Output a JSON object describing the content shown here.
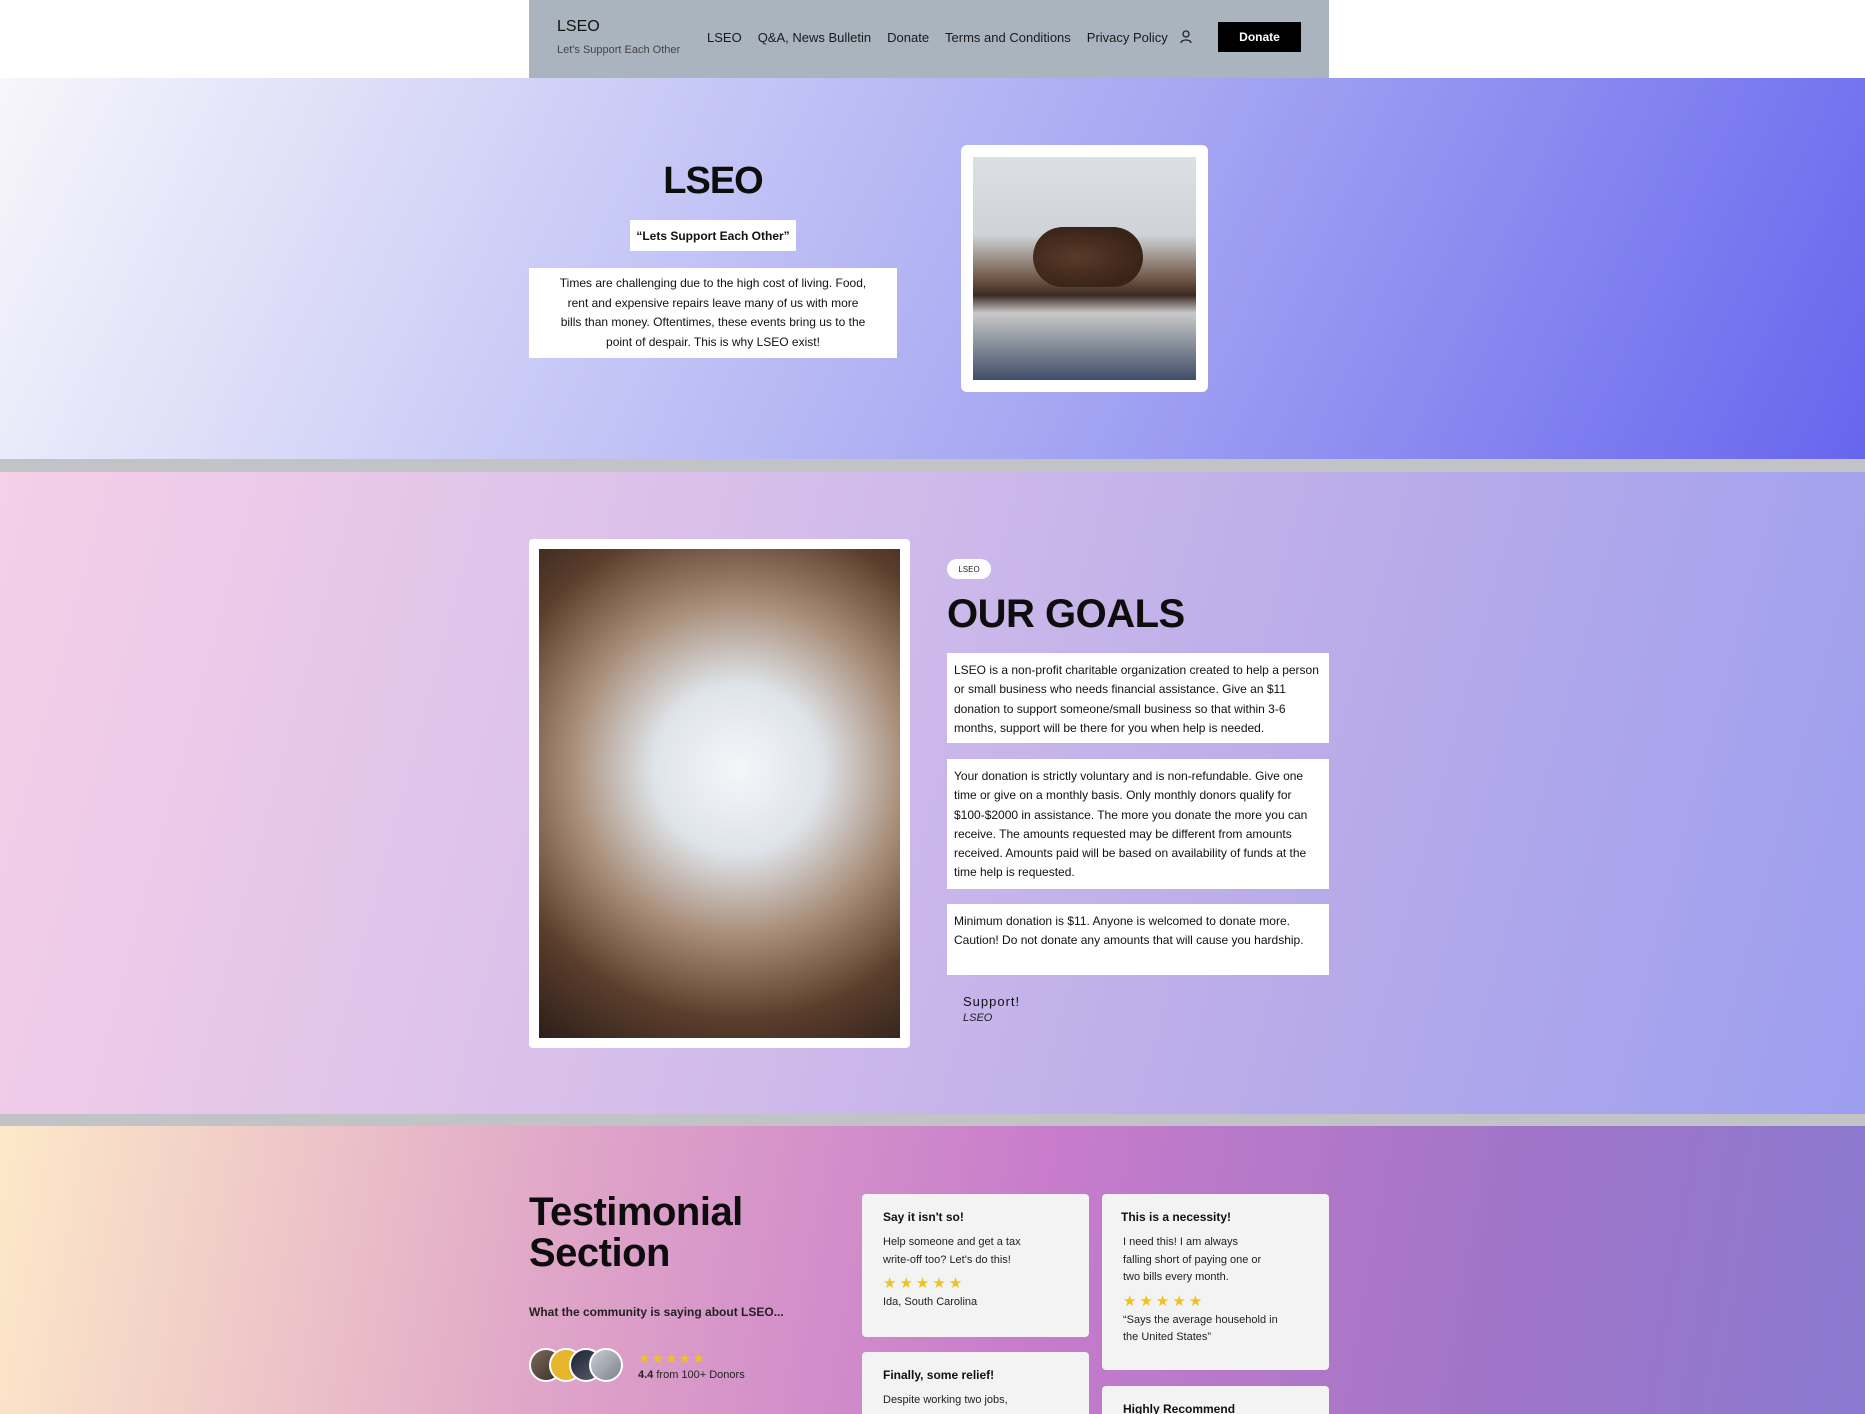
{
  "header": {
    "brand_title": "LSEO",
    "brand_subtitle": "Let's Support Each Other",
    "nav": [
      "LSEO",
      "Q&A, News Bulletin",
      "Donate",
      "Terms and Conditions",
      "Privacy Policy"
    ],
    "donate_label": "Donate"
  },
  "hero": {
    "title": "LSEO",
    "tagline": "“Lets Support Each Other”",
    "text": "Times are challenging due to the high cost of living. Food, rent and expensive repairs leave many of us with more bills than money.  Oftentimes, these events bring us to the point of despair.  This is why LSEO exist!"
  },
  "goals": {
    "tag": "LSEO",
    "title": "OUR GOALS",
    "paragraphs": [
      "LSEO is a non-profit charitable organization created to help a person or small business who needs financial assistance.  Give an $11 donation to support someone/small business so that within 3-6 months, support will be there for you when help is needed.",
      "Your donation is strictly voluntary and is non-refundable.  Give one time or give on a monthly basis.  Only monthly donors qualify for $100-$2000 in assistance.  The more you donate the more you can receive.  The amounts requested may be different from amounts received. Amounts paid will be based on availability of funds at the time help is requested.",
      "Minimum donation is $11.  Anyone is welcomed to donate more.  Caution!  Do not donate any amounts that will cause you hardship."
    ],
    "support_title": "Support!",
    "support_sub": "LSEO"
  },
  "testimonials": {
    "title": "Testimonial Section",
    "subtitle": "What the community is saying about LSEO...",
    "rating_stars": "★★★★★",
    "rating_value": "4.4",
    "rating_suffix": " from 100+ Donors",
    "cards": [
      {
        "title": "Say it isn't so!",
        "body": "Help someone and get a tax write-off too?  Let's do this!",
        "stars": "★★★★★",
        "author": "Ida, South Carolina"
      },
      {
        "title": "This is a necessity!",
        "body": "I need this!  I  am always falling short of paying one or two bills every month.",
        "stars": "★★★★★",
        "author": "“Says the average household in the United States”"
      },
      {
        "title": "Finally, some relief!",
        "body": "Despite working two jobs,"
      },
      {
        "title": "Highly Recommend",
        "body": ""
      }
    ]
  }
}
